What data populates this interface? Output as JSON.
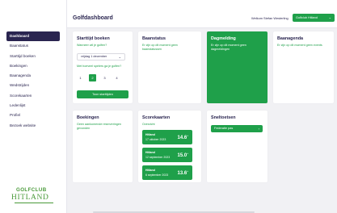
{
  "sidebar": {
    "items": [
      {
        "label": "Dashboard",
        "active": true
      },
      {
        "label": "Baanstatus"
      },
      {
        "label": "Starttijd boeken"
      },
      {
        "label": "Boekingen"
      },
      {
        "label": "Baanagenda"
      },
      {
        "label": "Wedstrijden"
      },
      {
        "label": "Scorekaarten"
      },
      {
        "label": "Ledenlijst"
      },
      {
        "label": "Profiel"
      },
      {
        "label": "Bezoek website"
      }
    ],
    "logo": {
      "top": "GOLFCLUB",
      "bottom": "HITLAND"
    }
  },
  "header": {
    "title": "Golfdashboard",
    "welcome": "Welkom Stefan Westerling",
    "club_select": "Golfclub Hitland",
    "user_icon": "user-icon"
  },
  "starttijd": {
    "title": "Starttijd boeken",
    "question1": "Wanneer wil je golfen?",
    "date_value": "vrijdag 1 december",
    "question2": "Met hoeveel spelers ga je golfen?",
    "players": [
      "1",
      "2",
      "3",
      "4"
    ],
    "selected_player": "2",
    "button": "Toon starttijden"
  },
  "baanstatus": {
    "title": "Baanstatus",
    "text": "Er zijn op dit moment geen baanstatussen"
  },
  "dagmelding": {
    "title": "Dagmelding",
    "text": "Er zijn op dit moment geen dagmeldingen"
  },
  "baanagenda": {
    "title": "Baanagenda",
    "text": "Er zijn op dit moment geen events"
  },
  "boekingen": {
    "title": "Boekingen",
    "text": "Geen aankomende reserveringen gevonden"
  },
  "scorekaarten": {
    "title": "Scorekaarten",
    "subtitle": "Overzicht",
    "items": [
      {
        "club": "Hitland",
        "date": "17 oktober 2023",
        "score": "14.6",
        "sup": "+"
      },
      {
        "club": "Hitland",
        "date": "12 september 2023",
        "score": "15.0",
        "sup": "+"
      },
      {
        "club": "Hitland",
        "date": "6 september 2023",
        "score": "13.6",
        "sup": "+"
      }
    ]
  },
  "sneltoetsen": {
    "title": "Sneltoetsen",
    "button": "Federatie pas"
  },
  "colors": {
    "brand_dark": "#2a2550",
    "accent_green": "#1fa04a",
    "background": "#f1f1f4"
  }
}
